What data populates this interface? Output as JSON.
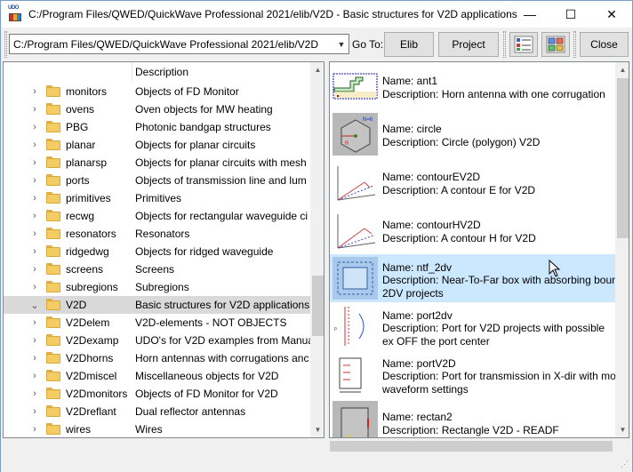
{
  "window": {
    "title": "C:/Program Files/QWED/QuickWave Professional 2021/elib/V2D - Basic structures for V2D applications",
    "app_icon_text": "UDO",
    "minimize": "—",
    "maximize": "☐",
    "close": "✕"
  },
  "toolbar": {
    "path_value": "C:/Program Files/QWED/QuickWave Professional 2021/elib/V2D",
    "goto_label": "Go To:",
    "elib_label": "Elib",
    "project_label": "Project",
    "close_label": "Close"
  },
  "left": {
    "col_description": "Description",
    "rows": [
      {
        "name": "monitors",
        "desc": "Objects of FD Monitor"
      },
      {
        "name": "ovens",
        "desc": "Oven objects for MW heating"
      },
      {
        "name": "PBG",
        "desc": "Photonic bandgap structures"
      },
      {
        "name": "planar",
        "desc": "Objects for planar circuits"
      },
      {
        "name": "planarsp",
        "desc": "Objects for planar circuits with mesh"
      },
      {
        "name": "ports",
        "desc": "Objects of transmission line and lum"
      },
      {
        "name": "primitives",
        "desc": "Primitives"
      },
      {
        "name": "recwg",
        "desc": "Objects for rectangular waveguide ci"
      },
      {
        "name": "resonators",
        "desc": "Resonators"
      },
      {
        "name": "ridgedwg",
        "desc": "Objects for ridged waveguide"
      },
      {
        "name": "screens",
        "desc": "Screens"
      },
      {
        "name": "subregions",
        "desc": "Subregions"
      },
      {
        "name": "V2D",
        "desc": "Basic structures for V2D applications"
      },
      {
        "name": "V2Delem",
        "desc": "V2D-elements - NOT OBJECTS"
      },
      {
        "name": "V2Dexamp",
        "desc": "UDO's for V2D examples from Manua"
      },
      {
        "name": "V2Dhorns",
        "desc": "Horn antennas with corrugations anc"
      },
      {
        "name": "V2Dmiscel",
        "desc": "Miscellaneous objects for V2D"
      },
      {
        "name": "V2Dmonitors",
        "desc": "Objects of FD Monitor for V2D"
      },
      {
        "name": "V2Dreflant",
        "desc": "Dual reflector antennas"
      },
      {
        "name": "wires",
        "desc": " Wires"
      }
    ]
  },
  "right": {
    "items": [
      {
        "name": "Name: ant1",
        "desc": "Description: Horn antenna with one corrugation"
      },
      {
        "name": "Name: circle",
        "desc": "Description: Circle (polygon) V2D"
      },
      {
        "name": "Name: contourEV2D",
        "desc": "Description: A contour E for V2D"
      },
      {
        "name": "Name: contourHV2D",
        "desc": "Description: A contour H for V2D"
      },
      {
        "name": "Name: ntf_2dv",
        "desc": "Description: Near-To-Far box with absorbing boun 2DV projects"
      },
      {
        "name": "Name: port2dv",
        "desc": "Description: Port for V2D projects with possible ex OFF the port center"
      },
      {
        "name": "Name: portV2D",
        "desc": "Description: Port for transmission in X-dir with mo waveform settings"
      },
      {
        "name": "Name: rectan2",
        "desc": "Description: Rectangle V2D - READF"
      }
    ],
    "thumb_label_circle": "N=6"
  },
  "colors": {
    "selection_right": "#cce8ff",
    "selection_left": "#d9d9d9",
    "folder": "#f3cc63"
  }
}
